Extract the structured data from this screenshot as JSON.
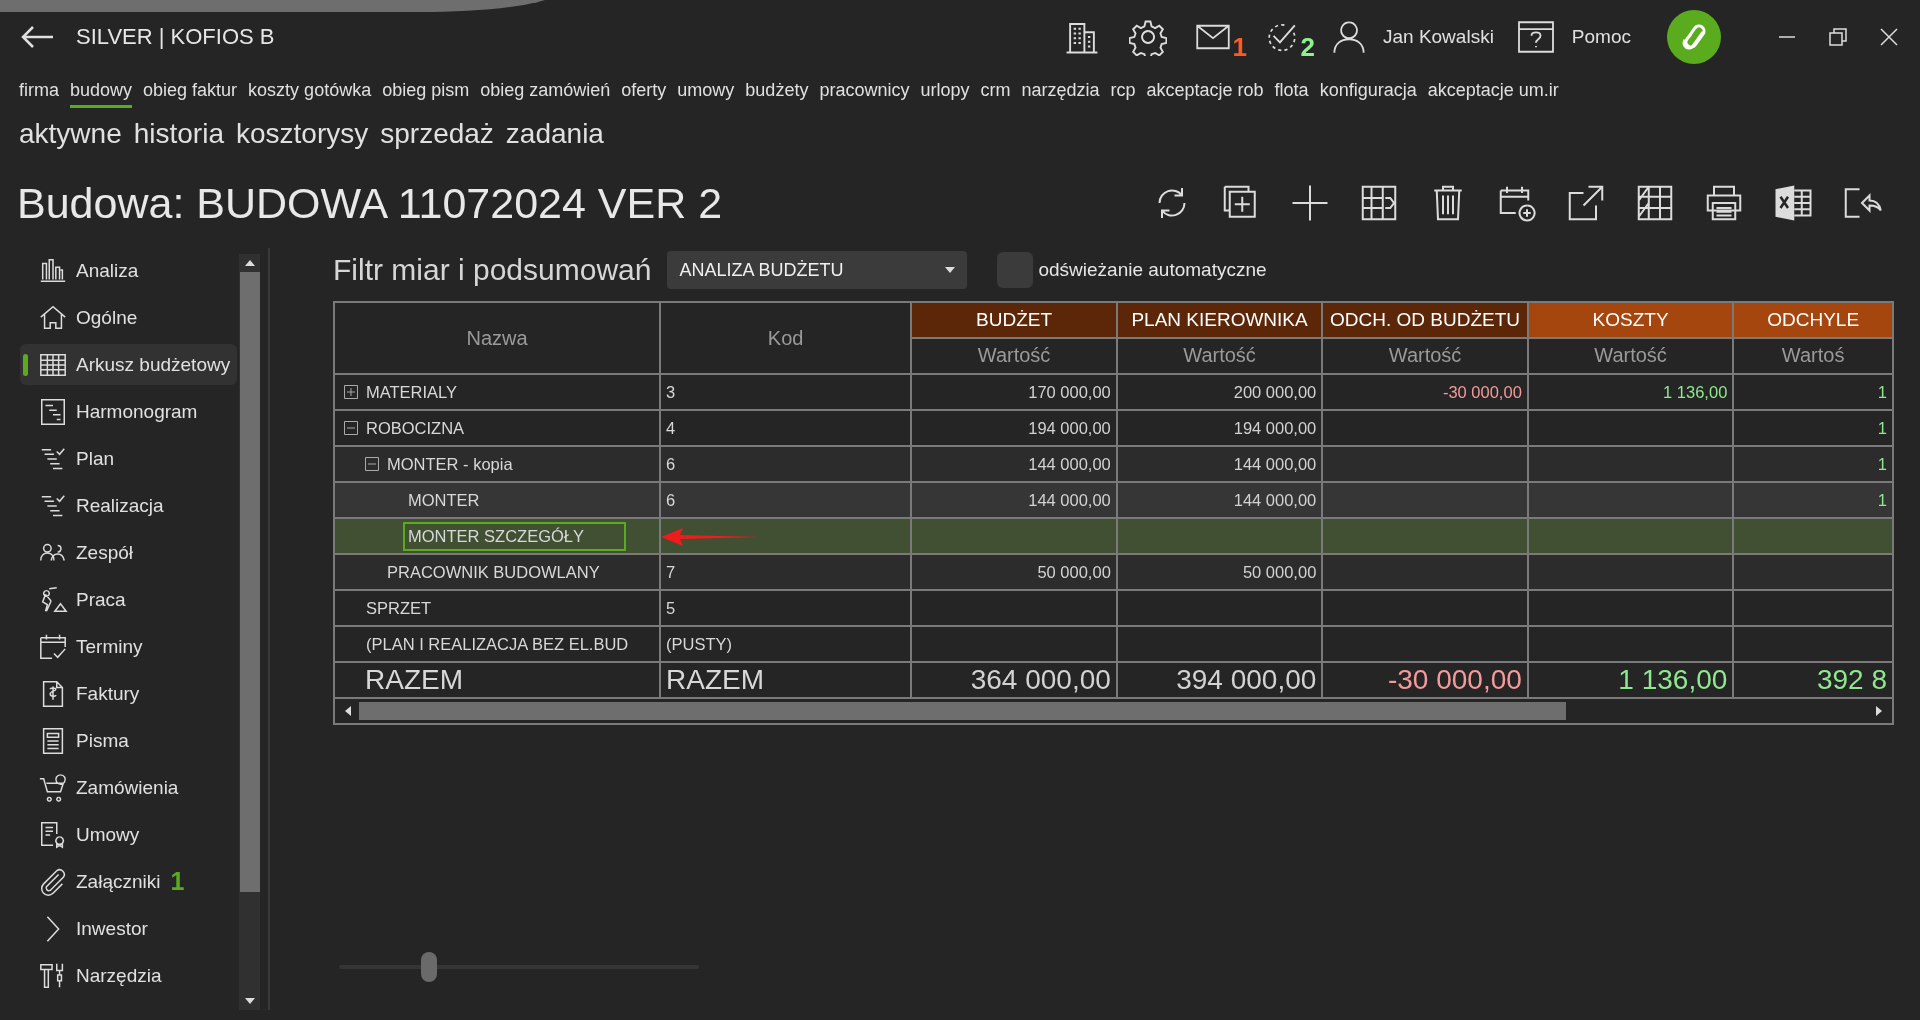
{
  "header": {
    "title": "SILVER | KOFIOS B",
    "notifications": [
      {
        "badge": "1",
        "color": "#ff5a1f"
      },
      {
        "badge": "2",
        "color": "#8ef08e"
      }
    ],
    "user": "Jan Kowalski",
    "help": "Pomoc"
  },
  "menu": [
    {
      "label": "firma",
      "selected": false
    },
    {
      "label": "budowy",
      "selected": true
    },
    {
      "label": "obieg faktur",
      "selected": false
    },
    {
      "label": "koszty gotówka",
      "selected": false
    },
    {
      "label": "obieg pism",
      "selected": false
    },
    {
      "label": "obieg zamówień",
      "selected": false
    },
    {
      "label": "oferty",
      "selected": false
    },
    {
      "label": "umowy",
      "selected": false
    },
    {
      "label": "budżety",
      "selected": false
    },
    {
      "label": "pracownicy",
      "selected": false
    },
    {
      "label": "urlopy",
      "selected": false
    },
    {
      "label": "crm",
      "selected": false
    },
    {
      "label": "narzędzia",
      "selected": false
    },
    {
      "label": "rcp",
      "selected": false
    },
    {
      "label": "akceptacje rob",
      "selected": false
    },
    {
      "label": "flota",
      "selected": false
    },
    {
      "label": "konfiguracja",
      "selected": false
    },
    {
      "label": "akceptacje um.ir",
      "selected": false
    }
  ],
  "submenu": [
    {
      "label": "aktywne",
      "selected": false
    },
    {
      "label": "historia",
      "selected": false
    },
    {
      "label": "kosztorysy",
      "selected": false
    },
    {
      "label": "sprzedaż",
      "selected": false
    },
    {
      "label": "zadania",
      "selected": false
    }
  ],
  "page_title": "Budowa: BUDOWA 11072024 VER 2",
  "sidebar": {
    "items": [
      {
        "label": "Analiza",
        "selected": false
      },
      {
        "label": "Ogólne",
        "selected": false
      },
      {
        "label": "Arkusz budżetowy",
        "selected": true
      },
      {
        "label": "Harmonogram",
        "selected": false
      },
      {
        "label": "Plan",
        "selected": false
      },
      {
        "label": "Realizacja",
        "selected": false
      },
      {
        "label": "Zespół",
        "selected": false
      },
      {
        "label": "Praca",
        "selected": false
      },
      {
        "label": "Terminy",
        "selected": false
      },
      {
        "label": "Faktury",
        "selected": false
      },
      {
        "label": "Pisma",
        "selected": false
      },
      {
        "label": "Zamówienia",
        "selected": false
      },
      {
        "label": "Umowy",
        "selected": false
      },
      {
        "label": "Załączniki",
        "selected": false,
        "badge": "1"
      },
      {
        "label": "Inwestor",
        "selected": false
      },
      {
        "label": "Narzędzia",
        "selected": false
      }
    ]
  },
  "filter": {
    "label": "Filtr miar i podsumowań",
    "value": "ANALIZA BUDŻETU",
    "auto_refresh": {
      "label": "odświeżanie automatyczne",
      "checked": false
    }
  },
  "table": {
    "columns": [
      {
        "label": "Nazwa"
      },
      {
        "label": "Kod"
      }
    ],
    "measures": [
      {
        "label": "BUDŻET",
        "sublabel": "Wartość",
        "color": "#5c2708",
        "kind": "plan"
      },
      {
        "label": "PLAN KIEROWNIKA",
        "sublabel": "Wartość",
        "color": "#5c2708",
        "kind": "plan"
      },
      {
        "label": "ODCH. OD BUDŻETU",
        "sublabel": "Wartość",
        "color": "#5c2708",
        "kind": "deviation"
      },
      {
        "label": "KOSZTY",
        "sublabel": "Wartość",
        "color": "#a6460f",
        "kind": "actual"
      },
      {
        "label": "ODCHYLE",
        "sublabel": "Wartoś",
        "color": "#a6460f",
        "kind": "actual"
      }
    ],
    "rows": [
      {
        "kind": "group",
        "expanded": false,
        "selected": false,
        "name": "MATERIALY",
        "code": "3",
        "budzet": "170 000,00",
        "plan_kierownika": "200 000,00",
        "odch_od_budzetu": "-30 000,00",
        "koszty": "1 136,00",
        "odchyle": "1"
      },
      {
        "kind": "group",
        "expanded": true,
        "selected": false,
        "name": "ROBOCIZNA",
        "code": "4",
        "budzet": "194 000,00",
        "plan_kierownika": "194 000,00",
        "odchyle": "1",
        "children": [
          {
            "kind": "group",
            "expanded": true,
            "selected": false,
            "name": "MONTER - kopia",
            "code": "6",
            "budzet": "144 000,00",
            "plan_kierownika": "144 000,00",
            "odchyle": "1",
            "children": [
              {
                "kind": "leaf",
                "selected": false,
                "name": "MONTER",
                "code": "6",
                "budzet": "144 000,00",
                "plan_kierownika": "144 000,00",
                "odchyle": "1"
              },
              {
                "kind": "leaf",
                "selected": true,
                "name": "MONTER SZCZEGÓŁY"
              }
            ]
          },
          {
            "kind": "leaf",
            "selected": false,
            "name": "PRACOWNIK BUDOWLANY",
            "code": "7",
            "budzet": "50 000,00",
            "plan_kierownika": "50 000,00"
          }
        ]
      },
      {
        "kind": "leaf",
        "selected": false,
        "name": "SPRZET",
        "code": "5"
      },
      {
        "kind": "leaf",
        "selected": false,
        "name": "(PLAN I REALIZACJA BEZ EL.BUD",
        "code": "(PUSTY)"
      }
    ],
    "totals": {
      "name": "RAZEM",
      "code": "RAZEM",
      "budzet": "364 000,00",
      "plan_kierownika": "394 000,00",
      "odch_od_budzetu": "-30 000,00",
      "koszty": "1 136,00",
      "odchyle": "392 8"
    }
  },
  "zoom_slider": {
    "level": 0.25
  }
}
